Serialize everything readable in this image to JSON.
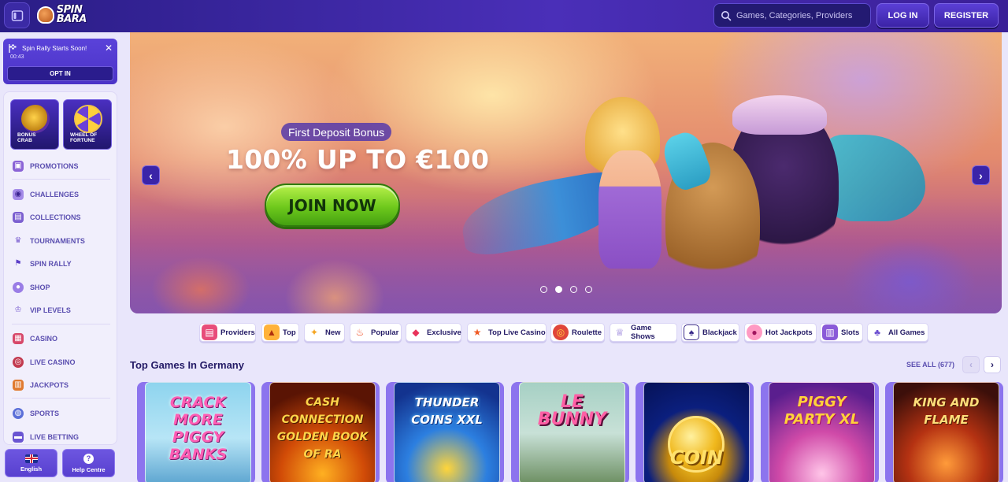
{
  "header": {
    "menu_toggle_icon": "sidebar-toggle-icon",
    "logo_text": "SPIN BARA",
    "search": {
      "placeholder": "Games, Categories, Providers",
      "icon": "search-icon"
    },
    "login_label": "LOG IN",
    "register_label": "REGISTER"
  },
  "rally_banner": {
    "title": "Spin Rally Starts Soon!",
    "timer": "00:43",
    "optin_label": "OPT IN"
  },
  "sidebar": {
    "tiles": [
      {
        "label_line1": "BONUS",
        "label_line2": "CRAB"
      },
      {
        "label_line1": "WHEEL OF",
        "label_line2": "FORTUNE"
      }
    ],
    "items": [
      {
        "label": "PROMOTIONS",
        "icon": "gift-icon"
      },
      {
        "label": "CHALLENGES",
        "icon": "challenge-icon"
      },
      {
        "label": "COLLECTIONS",
        "icon": "collections-icon"
      },
      {
        "label": "TOURNAMENTS",
        "icon": "trophy-icon"
      },
      {
        "label": "SPIN RALLY",
        "icon": "flag-icon"
      },
      {
        "label": "SHOP",
        "icon": "shop-icon"
      },
      {
        "label": "VIP LEVELS",
        "icon": "crown-icon"
      },
      {
        "label": "CASINO",
        "icon": "casino-icon"
      },
      {
        "label": "LIVE CASINO",
        "icon": "live-casino-icon"
      },
      {
        "label": "JACKPOTS",
        "icon": "jackpot-icon"
      },
      {
        "label": "SPORTS",
        "icon": "sports-icon"
      },
      {
        "label": "LIVE BETTING",
        "icon": "live-betting-icon"
      }
    ],
    "language_label": "English",
    "help_label": "Help Centre"
  },
  "hero": {
    "badge": "First Deposit Bonus",
    "headline": "100% UP TO €100",
    "cta": "JOIN NOW",
    "prev_icon": "chevron-left-icon",
    "next_icon": "chevron-right-icon",
    "slide_count": 4,
    "active_slide": 2
  },
  "categories": [
    {
      "label": "Providers",
      "icon": "providers-icon"
    },
    {
      "label": "Top",
      "icon": "top-icon"
    },
    {
      "label": "New",
      "icon": "new-icon"
    },
    {
      "label": "Popular",
      "icon": "fire-icon"
    },
    {
      "label": "Exclusive",
      "icon": "gem-icon"
    },
    {
      "label": "Top Live Casino",
      "icon": "star-icon"
    },
    {
      "label": "Roulette",
      "icon": "roulette-icon"
    },
    {
      "label": "Game Shows",
      "icon": "game-shows-icon"
    },
    {
      "label": "Blackjack",
      "icon": "cards-icon"
    },
    {
      "label": "Hot Jackpots",
      "icon": "hot-jackpot-icon"
    },
    {
      "label": "Slots",
      "icon": "slots-icon"
    },
    {
      "label": "All Games",
      "icon": "all-games-icon"
    }
  ],
  "top_games": {
    "title": "Top Games In Germany",
    "see_all": "SEE ALL (677)",
    "games": [
      {
        "title": "CRACK MORE PIGGY BANKS"
      },
      {
        "title": "CASH CONNECTION GOLDEN BOOK OF RA"
      },
      {
        "title": "THUNDER COINS XXL"
      },
      {
        "title": "LE BUNNY"
      },
      {
        "title": "COIN"
      },
      {
        "title": "PIGGY PARTY XL"
      },
      {
        "title": "KING AND FLAME"
      }
    ]
  },
  "colors": {
    "header_bg": "#2a1d86",
    "accent_purple": "#5840cf",
    "cta_green": "#6ec91c",
    "page_bg": "#e9e6fb"
  }
}
